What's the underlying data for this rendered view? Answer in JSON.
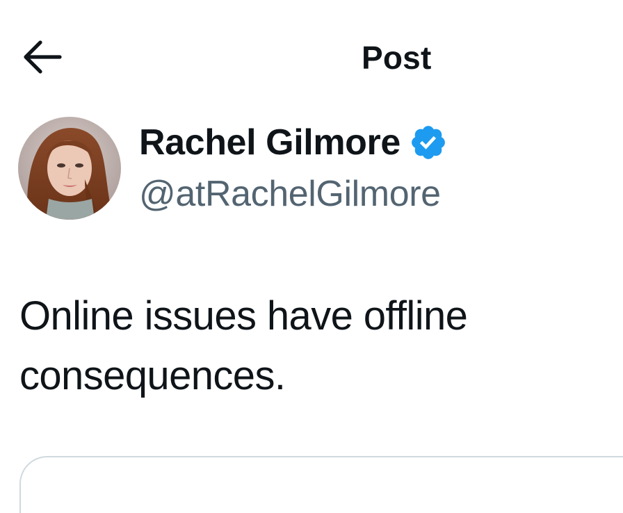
{
  "header": {
    "title": "Post",
    "back_icon": "arrow-left-icon"
  },
  "author": {
    "display_name": "Rachel Gilmore",
    "handle": "@atRachelGilmore",
    "verified_icon": "verified-badge-icon",
    "verified_color": "#1d9bf0",
    "avatar": "avatar-photo"
  },
  "post": {
    "text": "Online issues have offline consequences."
  },
  "colors": {
    "text_primary": "#0f1419",
    "text_secondary": "#536471",
    "border": "#cfd9de",
    "background": "#ffffff"
  }
}
